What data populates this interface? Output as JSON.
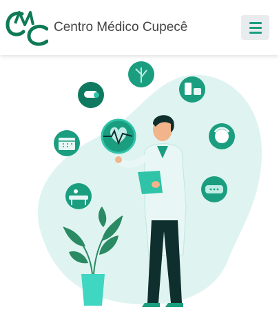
{
  "navbar": {
    "brand_name": "Centro Médico Cupecê",
    "logo_icon": "cmc-logo-icon",
    "menu_icon": "hamburger-menu-icon",
    "accent_color": "#1a9e7f"
  },
  "hero": {
    "illustration": "doctor-with-clipboard-illustration",
    "icons": [
      "plant-leaf-icon",
      "medicine-bottle-icon",
      "skincare-products-icon",
      "heart-rate-icon",
      "face-mask-icon",
      "massage-table-icon",
      "calendar-icon",
      "bandage-icon"
    ],
    "blob_color": "#dff4f1"
  }
}
